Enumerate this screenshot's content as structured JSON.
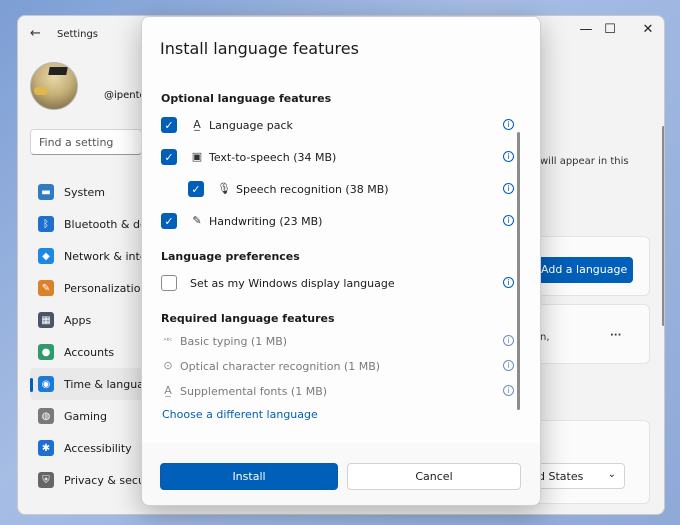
{
  "settings": {
    "title": "Settings",
    "back_icon": "back-arrow-icon",
    "username": "@ipente",
    "search_placeholder": "Find a setting",
    "window_controls": {
      "minimize": "—",
      "maximize": "☐",
      "close": "✕"
    },
    "nav": [
      {
        "label": "System",
        "icon": "monitor-icon",
        "color": "#2f7bc4"
      },
      {
        "label": "Bluetooth & devices",
        "icon": "bluetooth-icon",
        "color": "#1f6fcf"
      },
      {
        "label": "Network & internet",
        "icon": "wifi-icon",
        "color": "#1e88e5"
      },
      {
        "label": "Personalization",
        "icon": "brush-icon",
        "color": "#d9822b"
      },
      {
        "label": "Apps",
        "icon": "apps-icon",
        "color": "#4a5568"
      },
      {
        "label": "Accounts",
        "icon": "person-icon",
        "color": "#2e9c6a"
      },
      {
        "label": "Time & language",
        "icon": "globe-clock-icon",
        "color": "#1c7bd6",
        "active": true
      },
      {
        "label": "Gaming",
        "icon": "controller-icon",
        "color": "#7a7a7a"
      },
      {
        "label": "Accessibility",
        "icon": "accessibility-icon",
        "color": "#1d6fd1"
      },
      {
        "label": "Privacy & security",
        "icon": "shield-icon",
        "color": "#666666"
      }
    ],
    "background": {
      "hint_text": "will appear in this",
      "add_language_label": "Add a language",
      "snippet": "n,",
      "more_label": "···",
      "region_value": "d States"
    }
  },
  "dialog": {
    "title": "Install language features",
    "optional_heading": "Optional language features",
    "optional_items": [
      {
        "label": "Language pack",
        "checked": true,
        "icon": "language-pack-icon"
      },
      {
        "label": "Text-to-speech (34 MB)",
        "checked": true,
        "icon": "speech-bubble-icon"
      },
      {
        "label": "Speech recognition (38 MB)",
        "checked": true,
        "icon": "microphone-icon",
        "indented": true
      },
      {
        "label": "Handwriting (23 MB)",
        "checked": true,
        "icon": "pen-tablet-icon"
      }
    ],
    "preferences_heading": "Language preferences",
    "preference_item": {
      "label": "Set as my Windows display language",
      "checked": false
    },
    "required_heading": "Required language features",
    "required_items": [
      {
        "label": "Basic typing (1 MB)",
        "icon": "abc-check-icon"
      },
      {
        "label": "Optical character recognition (1 MB)",
        "icon": "camera-icon"
      },
      {
        "label": "Supplemental fonts (1 MB)",
        "icon": "font-icon"
      }
    ],
    "change_link": "Choose a different language",
    "install_label": "Install",
    "cancel_label": "Cancel"
  }
}
